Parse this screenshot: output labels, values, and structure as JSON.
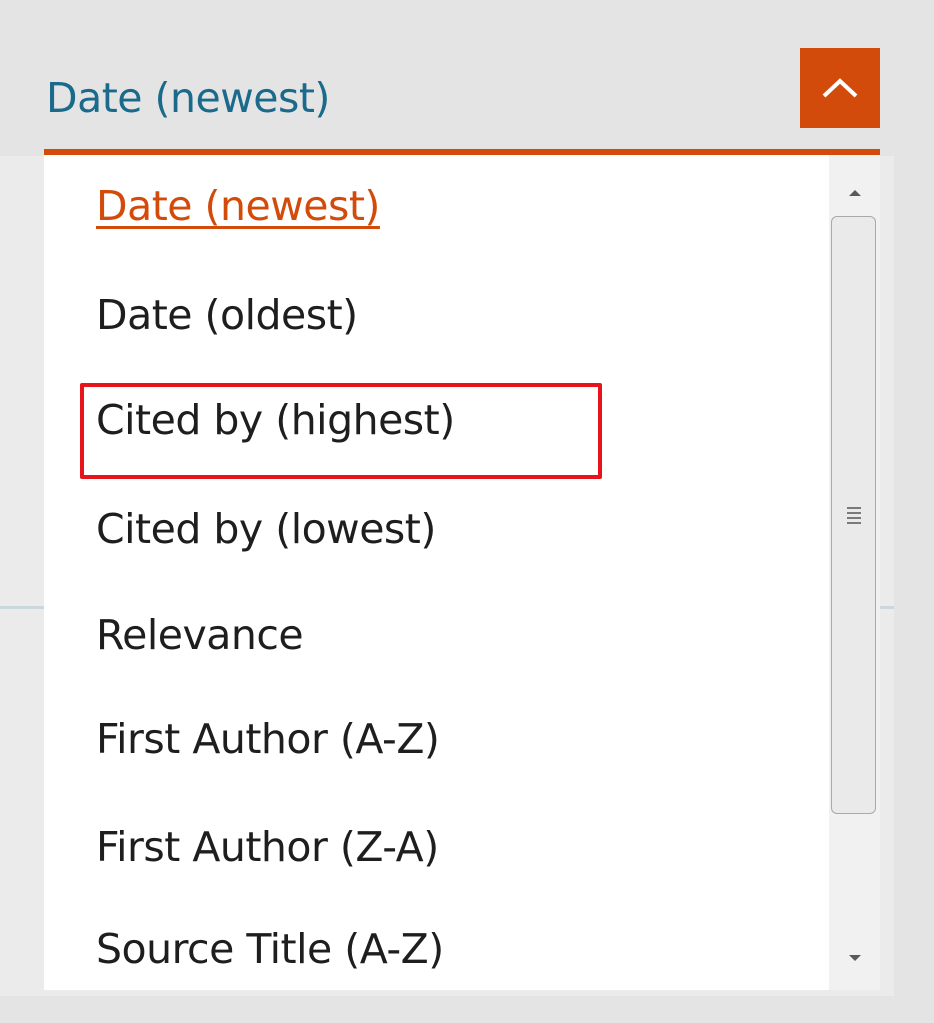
{
  "sort_dropdown": {
    "selected_value": "Date (newest)",
    "toggle_icon": "chevron-up-icon",
    "options": [
      "Date (newest)",
      "Date (oldest)",
      "Cited by (highest)",
      "Cited by (lowest)",
      "Relevance",
      "First Author (A-Z)",
      "First Author (Z-A)",
      "Source Title (A-Z)"
    ],
    "highlighted_option": "Cited by (highest)"
  },
  "scrollbar": {
    "up_icon": "scroll-up-arrow-icon",
    "down_icon": "scroll-down-arrow-icon",
    "grip_icon": "grip-lines-icon"
  },
  "colors": {
    "accent": "#d34b0b",
    "selected_text": "#1a6a8c",
    "highlight_border": "#e8141b",
    "background": "#e4e4e4"
  }
}
